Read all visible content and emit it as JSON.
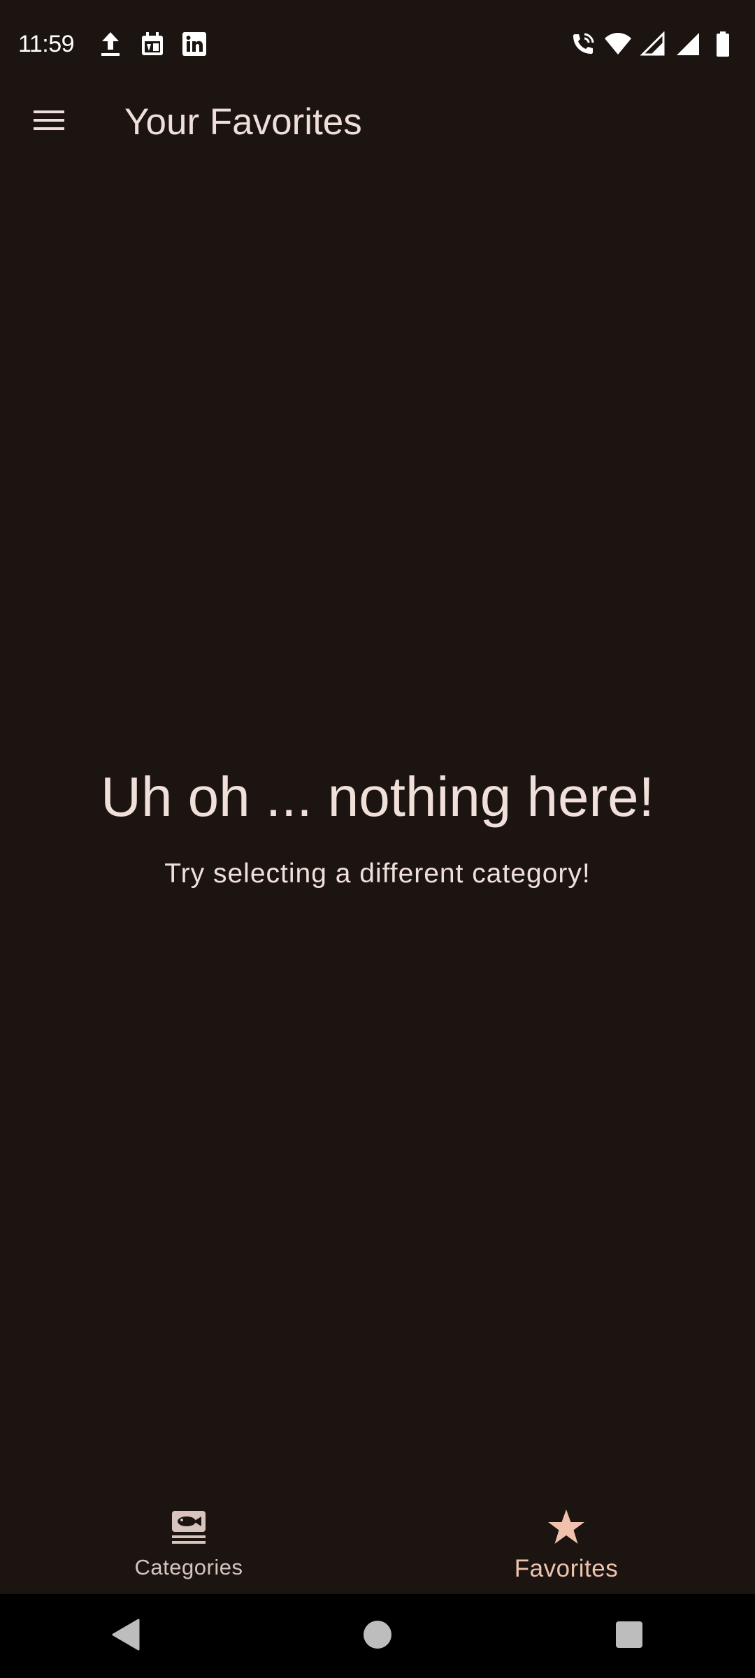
{
  "status_bar": {
    "time": "11:59",
    "left_icons": [
      "upload-icon",
      "calendar-icon",
      "linkedin-icon"
    ],
    "right_icons": [
      "wifi-calling-icon",
      "wifi-icon",
      "signal-icon",
      "signal-full-icon",
      "battery-icon"
    ]
  },
  "app_bar": {
    "menu_icon": "hamburger-menu-icon",
    "title": "Your Favorites"
  },
  "empty_state": {
    "title": "Uh oh ... nothing here!",
    "subtitle": "Try selecting a different category!"
  },
  "bottom_nav": {
    "items": [
      {
        "label": "Categories",
        "icon": "set-meal-icon",
        "selected": false
      },
      {
        "label": "Favorites",
        "icon": "star-icon",
        "selected": true
      }
    ]
  },
  "system_nav": {
    "buttons": [
      "back-icon",
      "home-icon",
      "recents-icon"
    ]
  },
  "colors": {
    "background": "#1b1411",
    "text": "#f0dfd8",
    "accent": "#f0c2ad",
    "system_nav": "#000000"
  }
}
